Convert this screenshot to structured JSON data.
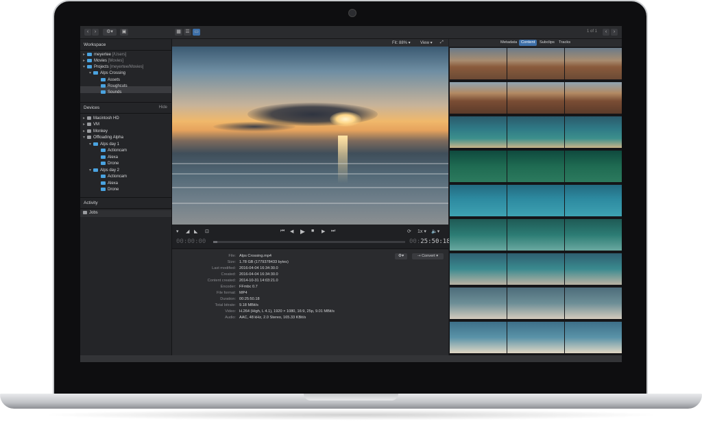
{
  "toolbar": {
    "back_icon": "chevron-left-icon",
    "forward_icon": "chevron-right-icon",
    "gear_icon": "gear-icon",
    "new_folder_icon": "new-folder-icon",
    "view_modes": [
      "grid-view-icon",
      "list-view-icon",
      "filmstrip-view-icon"
    ],
    "pager": "1 of 1"
  },
  "sidebar": {
    "workspace_title": "Workspace",
    "workspace_items": [
      {
        "label": "meyertee",
        "path": "[/Users]"
      },
      {
        "label": "Movies",
        "path": "[Movies]"
      },
      {
        "label": "Projects",
        "path": "[meyertee/Movies]"
      },
      {
        "label": "Alps Crossing",
        "path": ""
      },
      {
        "label": "Assets",
        "path": ""
      },
      {
        "label": "Roughcuts",
        "path": ""
      },
      {
        "label": "Sounds",
        "path": ""
      }
    ],
    "devices_title": "Devices",
    "devices_hide": "Hide",
    "device_items": [
      {
        "label": "Macintosh HD"
      },
      {
        "label": "VM"
      },
      {
        "label": "Monkey"
      },
      {
        "label": "Offloading Alpha"
      },
      {
        "label": "Alps day 1"
      },
      {
        "label": "Actioncam"
      },
      {
        "label": "Alexa"
      },
      {
        "label": "Drone"
      },
      {
        "label": "Alps day 2"
      },
      {
        "label": "Actioncam"
      },
      {
        "label": "Alexa"
      },
      {
        "label": "Drone"
      }
    ],
    "activity_title": "Activity",
    "activity_items": [
      {
        "label": "Jobs"
      }
    ]
  },
  "viewer": {
    "fit_label": "Fit: 88%",
    "view_label": "View",
    "timecode_start": "00:00:00",
    "timecode_end": "25:50:18",
    "timecode_end_prefix": "00:",
    "speed_label": "1x",
    "playhead_progress": 0.02
  },
  "info": {
    "convert_label": "Convert",
    "rows": [
      {
        "key": "File:",
        "value": "Alps Crossing.mp4"
      },
      {
        "key": "Size:",
        "value": "1.78 GB (1779378433 bytes)"
      },
      {
        "key": "Last modified:",
        "value": "2016-04-04 16:34:30.0"
      },
      {
        "key": "Created:",
        "value": "2016-04-04 16:34:30.0"
      },
      {
        "key": "Content created:",
        "value": "2014-10-31 14:03:21.0"
      },
      {
        "key": "Encoder:",
        "value": "FFmbc 0.7"
      },
      {
        "key": "File format:",
        "value": "MP4"
      },
      {
        "key": "Duration:",
        "value": "00:25:50.18"
      },
      {
        "key": "Total bitrate:",
        "value": "9.18 MBit/s"
      },
      {
        "key": "Video:",
        "value": "H.264 (High, L 4.1), 1920 × 1080, 16:9, 25p, 9.01 MBit/s"
      },
      {
        "key": "Audio:",
        "value": "AAC, 48 kHz, 2.0 Stereo, 165.33 KBit/s"
      }
    ]
  },
  "right_panel": {
    "tabs": [
      "Metadata",
      "Content",
      "Subclips",
      "Tracks"
    ],
    "active_tab": "Content",
    "thumbnail_count": 27
  },
  "colors": {
    "accent": "#3d6fa8",
    "folder": "#4aa3e0",
    "screen_bg": "#1e1f22"
  }
}
